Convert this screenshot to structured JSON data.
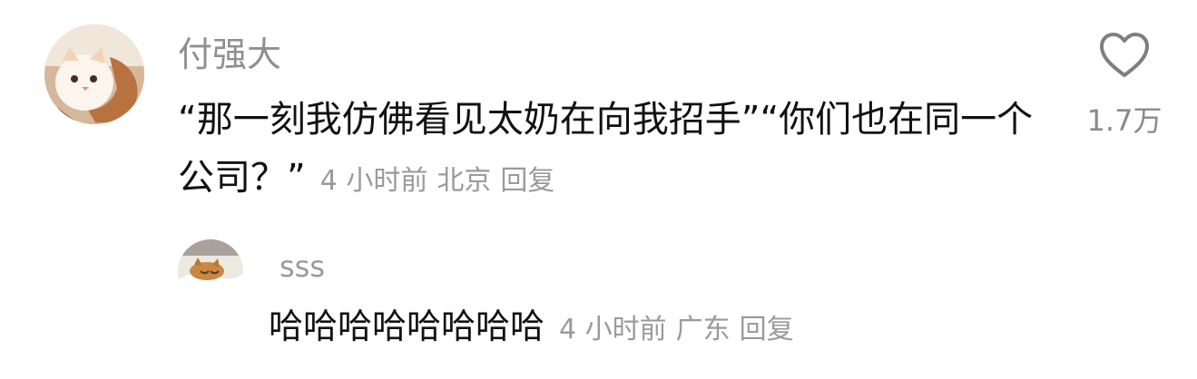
{
  "comment": {
    "username": "付强大",
    "text": "“那一刻我仿佛看见太奶在向我招手”“你们也在同一个公司？”",
    "time": "4 小时前",
    "location": "北京",
    "reply_label": "回复",
    "like_count": "1.7万"
  },
  "reply": {
    "username": "sss",
    "text": "哈哈哈哈哈哈哈哈",
    "time": "4 小时前",
    "location": "广东",
    "reply_label": "回复"
  },
  "icons": {
    "like": "heart-outline-icon"
  },
  "colors": {
    "username": "#8f8f8f",
    "meta": "#9a9a9a",
    "text": "#111111"
  }
}
